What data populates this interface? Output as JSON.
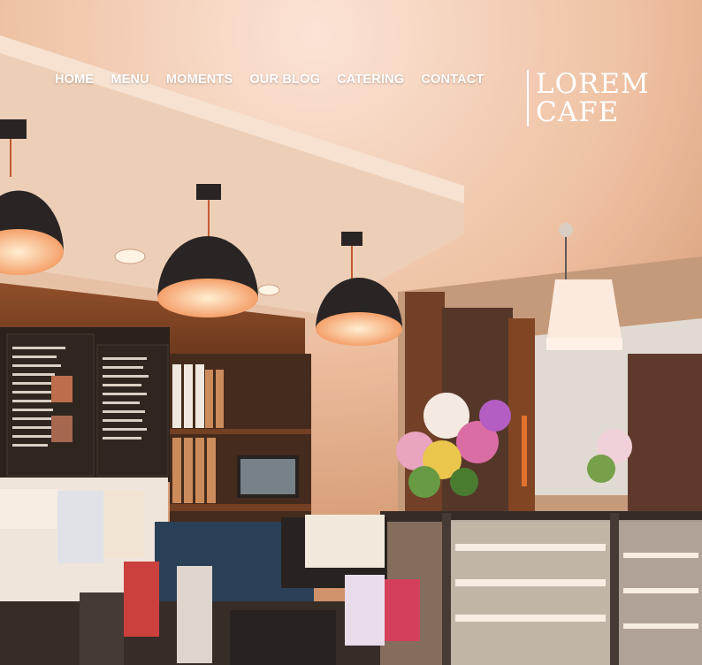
{
  "nav": {
    "items": [
      {
        "label": "HOME"
      },
      {
        "label": "MENU"
      },
      {
        "label": "MOMENTS"
      },
      {
        "label": "OUR BLOG"
      },
      {
        "label": "CATERING"
      },
      {
        "label": "CONTACT"
      }
    ]
  },
  "logo": {
    "line1": "LOREM",
    "line2": "CAFE"
  },
  "colors": {
    "nav_text": "#ffffff",
    "ceiling": "#f2d8c4",
    "wood": "#7a3e1e"
  }
}
